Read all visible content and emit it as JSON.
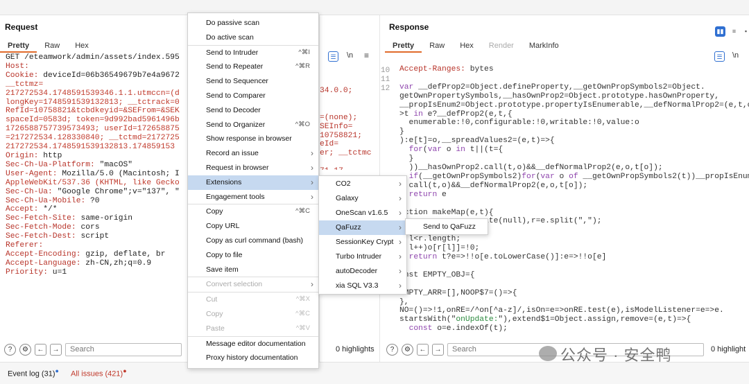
{
  "request": {
    "title": "Request",
    "tabs": [
      "Pretty",
      "Raw",
      "Hex"
    ],
    "lines": [
      "GET /eteamwork/admin/assets/index.595",
      "Host:",
      "Cookie: deviceId=06b36549679b7e4a9672",
      "__tctmz=",
      "217272534.1748591539346.1.1.utmccn=(d",
      "longKey=1748591539132813; __tctrack=0",
      "RefId=10758821&tcbdkeyid=&SEFrom=&SEK",
      "spaceId=0583d; token=9d992bad5961496b",
      "1726588757739573493; userId=172658875",
      "=217272534.128330840; __tctmd=2172725",
      "217272534.1748591539132813.174859153",
      "Origin: http",
      "Sec-Ch-Ua-Platform: \"macOS\"",
      "User-Agent: Mozilla/5.0 (Macintosh; I",
      "AppleWebKit/537.36 (KHTML, like Gecko",
      "Sec-Ch-Ua: \"Google Chrome\";v=\"137\", \"",
      "Sec-Ch-Ua-Mobile: ?0",
      "Accept: */*",
      "Sec-Fetch-Site: same-origin",
      "Sec-Fetch-Mode: cors",
      "Sec-Fetch-Dest: script",
      "Referer:",
      "Accept-Encoding: gzip, deflate, br",
      "Accept-Language: zh-CN,zh;q=0.9",
      "Priority: u=1"
    ],
    "search_placeholder": "Search"
  },
  "middle": {
    "lines": [
      "34.0.0;",
      "",
      "",
      "=(none);",
      "SEInfo=",
      "10758821;",
      "eId=",
      "er; __tctmc",
      "",
      "71.17"
    ],
    "highlights": "0 highlights"
  },
  "response": {
    "title": "Response",
    "tabs": [
      "Pretty",
      "Raw",
      "Hex",
      "Render",
      "MarkInfo"
    ],
    "line_numbers": [
      "10",
      "11",
      "12"
    ],
    "lines": [
      "Accept-Ranges: bytes",
      "",
      "var __defProp2=Object.defineProperty,__getOwnPropSymbols2=Object.",
      "getOwnPropertySymbols,__hasOwnProp2=Object.prototype.hasOwnProperty,",
      "__propIsEnum2=Object.prototype.propertyIsEnumerable,__defNormalProp2=(e,t,o)",
      ">t in e?__defProp2(e,t,{",
      "  enumerable:!0,configurable:!0,writable:!0,value:o",
      "}",
      "):e[t]=o,__spreadValues2=(e,t)=>{",
      "  for(var o in t||(t={",
      "  }",
      "  ))__hasOwnProp2.call(t,o)&&__defNormalProp2(e,o,t[o]);",
      "  if(__getOwnPropSymbols2)for(var o of __getOwnPropSymbols2(t))__propIsEnum2",
      "  call(t,o)&&__defNormalProp2(e,o,t[o]);",
      "  return e",
      "",
      "nction makeMap(e,t){",
      "                 eate(null),r=e.split(\",\");",
      "",
      "  l<r.length;",
      "  l++)o[r[l]]=!0;",
      "  return t?e=>!!o[e.toLowerCase()]:e=>!!o[e]",
      "",
      "onst EMPTY_OBJ={",
      "",
      "EMPTY_ARR=[],NOOP$7=()=>{",
      "},",
      "NO=()=>!1,onRE=/^on[^a-z]/,isOn=e=>onRE.test(e),isModelListener=e=>e.",
      "startsWith(\"onUpdate:\"),extend$1=Object.assign,remove=(e,t)=>{",
      "  const o=e.indexOf(t);"
    ],
    "search_placeholder": "Search",
    "highlights": "0 highlight"
  },
  "context_menu": {
    "items": [
      {
        "label": "Do passive scan",
        "shortcut": "",
        "arrow": false,
        "disabled": false
      },
      {
        "label": "Do active scan",
        "shortcut": "",
        "arrow": false,
        "disabled": false
      },
      {
        "sep": true
      },
      {
        "label": "Send to Intruder",
        "shortcut": "^⌘I",
        "arrow": false,
        "disabled": false
      },
      {
        "label": "Send to Repeater",
        "shortcut": "^⌘R",
        "arrow": false,
        "disabled": false
      },
      {
        "label": "Send to Sequencer",
        "shortcut": "",
        "arrow": false,
        "disabled": false
      },
      {
        "label": "Send to Comparer",
        "shortcut": "",
        "arrow": false,
        "disabled": false
      },
      {
        "label": "Send to Decoder",
        "shortcut": "",
        "arrow": false,
        "disabled": false
      },
      {
        "label": "Send to Organizer",
        "shortcut": "^⌘O",
        "arrow": false,
        "disabled": false
      },
      {
        "label": "Show response in browser",
        "shortcut": "",
        "arrow": false,
        "disabled": false
      },
      {
        "label": "Record an issue",
        "shortcut": "",
        "arrow": true,
        "disabled": false
      },
      {
        "label": "Request in browser",
        "shortcut": "",
        "arrow": true,
        "disabled": false
      },
      {
        "label": "Extensions",
        "shortcut": "",
        "arrow": true,
        "disabled": false,
        "highlighted": true
      },
      {
        "label": "Engagement tools",
        "shortcut": "",
        "arrow": true,
        "disabled": false
      },
      {
        "sep": true
      },
      {
        "label": "Copy",
        "shortcut": "^⌘C",
        "arrow": false,
        "disabled": false
      },
      {
        "label": "Copy URL",
        "shortcut": "",
        "arrow": false,
        "disabled": false
      },
      {
        "label": "Copy as curl command (bash)",
        "shortcut": "",
        "arrow": false,
        "disabled": false
      },
      {
        "label": "Copy to file",
        "shortcut": "",
        "arrow": false,
        "disabled": false
      },
      {
        "label": "Save item",
        "shortcut": "",
        "arrow": false,
        "disabled": false
      },
      {
        "sep": true
      },
      {
        "label": "Convert selection",
        "shortcut": "",
        "arrow": true,
        "disabled": true
      },
      {
        "sep": true
      },
      {
        "label": "Cut",
        "shortcut": "^⌘X",
        "arrow": false,
        "disabled": true
      },
      {
        "label": "Copy",
        "shortcut": "^⌘C",
        "arrow": false,
        "disabled": true
      },
      {
        "label": "Paste",
        "shortcut": "^⌘V",
        "arrow": false,
        "disabled": true
      },
      {
        "sep": true
      },
      {
        "label": "Message editor documentation",
        "shortcut": "",
        "arrow": false,
        "disabled": false
      },
      {
        "label": "Proxy history documentation",
        "shortcut": "",
        "arrow": false,
        "disabled": false
      }
    ]
  },
  "extensions_menu": {
    "items": [
      {
        "label": "CO2",
        "highlighted": false
      },
      {
        "label": "Galaxy",
        "highlighted": false
      },
      {
        "label": "OneScan v1.6.5",
        "highlighted": false
      },
      {
        "label": "QaFuzz",
        "highlighted": true
      },
      {
        "label": "SessionKey Crypt",
        "highlighted": false
      },
      {
        "label": "Turbo Intruder",
        "highlighted": false
      },
      {
        "label": "autoDecoder",
        "highlighted": false
      },
      {
        "label": "xia SQL V3.3",
        "highlighted": false
      }
    ]
  },
  "qafuzz_menu": {
    "item": "Send to QaFuzz"
  },
  "status": {
    "event_log": "Event log (31)",
    "all_issues": "All issues (421)"
  },
  "watermark": "公众号 · 安全鸭",
  "colors": {
    "accent_orange": "#e06a2a",
    "menu_highlight": "#c6d9f0",
    "header_key": "#b8342a",
    "info_blue": "#2f6fd1"
  }
}
